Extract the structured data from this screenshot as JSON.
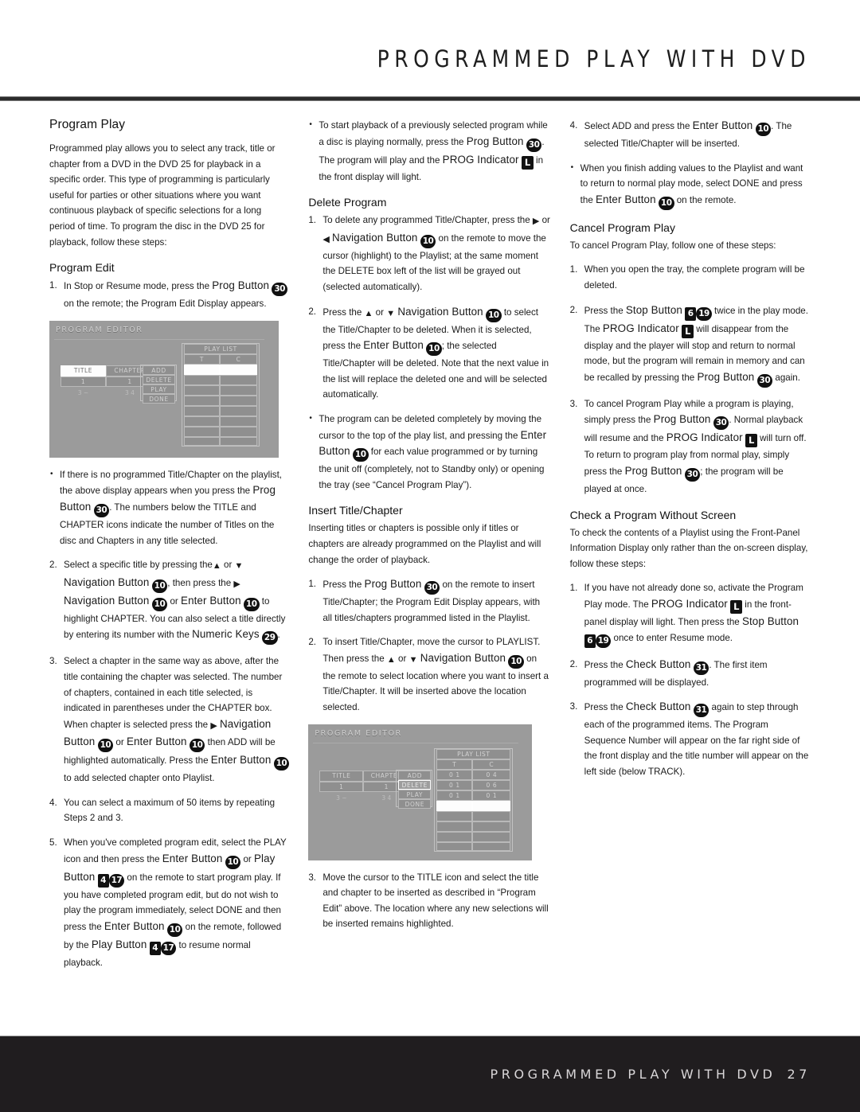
{
  "header": {
    "title": "PROGRAMMED PLAY WITH DVD"
  },
  "footer": {
    "title": "PROGRAMMED PLAY WITH DVD",
    "page": "27"
  },
  "column1": {
    "heading": "Program Play",
    "intro": "Programmed play allows you to select any track, title or chapter from a DVD in the DVD 25 for playback in a specific order. This type of programming is particularly useful for parties or other situations where you want continuous playback of specific selections for a long period of time. To program the disc in the DVD 25 for playback, follow these steps:",
    "subheading": "Program Edit",
    "step1_num": "1.",
    "step1_a": "In Stop or Resume mode, press the ",
    "step1_prog": "Prog Button",
    "step1_key": "30",
    "step1_b": " on the remote; the Program Edit Display appears.",
    "bullet1_a": "If there is no programmed Title/Chapter on the playlist, the above display appears when you press the ",
    "bullet1_prog": "Prog Button",
    "bullet1_key": "30",
    "bullet1_b": ". The numbers below the TITLE and CHAPTER icons indicate the number of Titles on the disc and Chapters in any title selected.",
    "step2_num": "2.",
    "step2_a": "Select a specific title by pressing the",
    "step2_up": "▲",
    "step2_or": " or ",
    "step2_down": "▼",
    "step2_nav1": "Navigation Button",
    "step2_key1": "10",
    "step2_b": ", then press the ",
    "step2_right": "▶",
    "step2_nav2": "Navigation Button",
    "step2_key2": "10",
    "step2_c": " or ",
    "step2_enter": "Enter Button",
    "step2_key3": "10",
    "step2_d": " to highlight CHAPTER. You can also select a title directly by entering its number with the ",
    "step2_numeric": "Numeric Keys",
    "step2_key4": "29",
    "step2_e": ".",
    "step3_num": "3.",
    "step3_a": "Select a chapter in the same way as above, after the title containing the chapter was selected. The number of chapters, contained in each title selected, is indicated in parentheses under the CHAPTER box. When chapter is selected press the ",
    "step3_right": "▶",
    "step3_nav": "Navigation Button",
    "step3_key1": "10",
    "step3_b": " or  ",
    "step3_enter1": "Enter Button",
    "step3_key2": "10",
    "step3_c": " then ADD will be highlighted automatically. Press the ",
    "step3_enter2": "Enter Button",
    "step3_key3": "10",
    "step3_d": " to add selected chapter onto Playlist.",
    "step4_num": "4.",
    "step4": "You can select a maximum of 50 items by repeating Steps 2 and 3.",
    "step5_num": "5.",
    "step5_a": "When you've completed program edit, select the PLAY icon and then press the ",
    "step5_enter1": "Enter Button",
    "step5_key1": "10",
    "step5_b": " or ",
    "step5_play1": "Play Button",
    "step5_key2a": "4",
    "step5_key2b": "17",
    "step5_c": " on the remote to start program play. If you have completed program edit, but do not wish to play the program immediately, select DONE and then press the ",
    "step5_enter2": "Enter Button",
    "step5_key3": "10",
    "step5_d": " on the remote, followed by the ",
    "step5_play2": "Play Button",
    "step5_key4a": "4",
    "step5_key4b": "17",
    "step5_e": " to resume normal playback."
  },
  "column2": {
    "bullet1_a": "To start playback of a previously selected program while a disc is playing normally, press the ",
    "bullet1_prog": "Prog Button",
    "bullet1_key": "30",
    "bullet1_b": ". The program will play and the ",
    "bullet1_prog_ind": "PROG Indicator",
    "bullet1_key2": "L",
    "bullet1_c": " in the front display will light.",
    "subheading1": "Delete Program",
    "step1_num": "1.",
    "step1_a": "To delete any programmed Title/Chapter, press the ",
    "step1_right": "▶",
    "step1_or": " or ",
    "step1_left": "◀",
    "step1_nav": "Navigation Button",
    "step1_key": "10",
    "step1_b": " on the remote to move the cursor (highlight) to the Playlist; at the same moment the DELETE box left of the list will be grayed out (selected automatically).",
    "step2_num": "2.",
    "step2_a": "Press the ",
    "step2_up": "▲",
    "step2_or": " or ",
    "step2_down": "▼",
    "step2_nav": "Navigation Button",
    "step2_key1": "10",
    "step2_b": " to select the Title/Chapter to be deleted. When it is selected, press the ",
    "step2_enter": "Enter Button",
    "step2_key2": "10",
    "step2_c": "; the selected Title/Chapter will be deleted. Note that the next value in the list will replace the deleted one and will be selected automatically.",
    "bullet2_a": "The program can be deleted completely by moving the cursor to the top of the play list, and pressing the ",
    "bullet2_enter": "Enter Button",
    "bullet2_key": "10",
    "bullet2_b": " for each value programmed or by turning the unit off (completely, not to Standby only) or opening the tray (see “Cancel Program Play”).",
    "subheading2": "Insert Title/Chapter",
    "para2": "Inserting titles or chapters is possible only if titles or chapters are already programmed on the Playlist and will change the order of playback.",
    "step3_num": "1.",
    "step3_a": "Press the ",
    "step3_prog": "Prog Button",
    "step3_key": "30",
    "step3_b": " on the remote to insert Title/Chapter; the Program Edit Display appears, with all titles/chapters programmed listed in the Playlist.",
    "step4_num": "2.",
    "step4_a": "To insert Title/Chapter, move the cursor to PLAYLIST. Then press the ",
    "step4_up": "▲",
    "step4_or": " or ",
    "step4_down": "▼",
    "step4_nav": "Navigation Button",
    "step4_key": "10",
    "step4_b": " on the remote to select location where you want to insert a Title/Chapter. It will be inserted above the location selected.",
    "step5_num": "3.",
    "step5": "Move the cursor to the TITLE icon and select the title and chapter to be inserted as described in “Program Edit” above. The location where any new selections will be inserted remains highlighted."
  },
  "column3": {
    "step1_num": "4.",
    "step1_a": "Select ADD and press the ",
    "step1_enter": "Enter Button",
    "step1_key": "10",
    "step1_b": ". The selected Title/Chapter will be inserted.",
    "bullet1_a": "When you finish adding values to the Playlist and want to return to normal play mode, select DONE and press the ",
    "bullet1_enter": "Enter Button",
    "bullet1_key": "10",
    "bullet1_b": " on the remote.",
    "subheading1": "Cancel Program Play",
    "para1": "To cancel Program Play, follow one of these steps:",
    "step2_num": "1.",
    "step2": "When you open the tray, the complete program will be deleted.",
    "step3_num": "2.",
    "step3_a": "Press the ",
    "step3_stop": "Stop Button",
    "step3_key1a": "6",
    "step3_key1b": "19",
    "step3_b": " twice in the play mode. The ",
    "step3_prog_ind": "PROG Indicator",
    "step3_key2": "L",
    "step3_c": " will disappear from the display and the player will stop and return to normal mode, but the program will remain in memory and can be recalled by pressing the ",
    "step3_prog": "Prog Button",
    "step3_key3": "30",
    "step3_d": " again.",
    "step4_num": "3.",
    "step4_a": "To cancel Program Play while a program is playing, simply press the ",
    "step4_prog1": "Prog Button",
    "step4_key1": "30",
    "step4_b": ". Normal playback will resume and the ",
    "step4_prog_ind": "PROG Indicator",
    "step4_key2": "L",
    "step4_c": " will turn off. To return to program play from normal play, simply press the ",
    "step4_prog2": "Prog Button",
    "step4_key3": "30",
    "step4_d": "; the program will be played at once.",
    "subheading2": "Check a Program Without Screen",
    "para2": "To check the contents of a Playlist using the Front-Panel Information Display only rather than the on-screen display, follow these steps:",
    "step5_num": "1.",
    "step5_a": "If you have not already done so, activate the Program Play mode. The ",
    "step5_prog_ind": "PROG Indicator",
    "step5_key1": "L",
    "step5_b": " in the front-panel display will light. Then press the ",
    "step5_stop": "Stop Button",
    "step5_key2a": "6",
    "step5_key2b": "19",
    "step5_c": " once to enter Resume mode.",
    "step6_num": "2.",
    "step6_a": "Press the ",
    "step6_check": "Check Button",
    "step6_key": "31",
    "step6_b": ". The first item programmed will be displayed.",
    "step7_num": "3.",
    "step7_a": "Press the ",
    "step7_check": "Check Button",
    "step7_key": "31",
    "step7_b": " again to step through each of the programmed items. The Program Sequence Number will appear on the far right side of the front display and the title number will appear on the left side (below TRACK)."
  },
  "osd1": {
    "title": "PROGRAM EDITOR",
    "title_label": "TITLE",
    "chapter_label": "CHAPTER",
    "title_value": "1",
    "chapter_value": "1",
    "title_count": "3 ~",
    "chapter_count": "3 4",
    "menu": [
      "ADD",
      "DELETE",
      "PLAY",
      "DONE"
    ],
    "playlist_label": "PLAY LIST",
    "col_t": "T",
    "col_c": "C",
    "rows": [
      {
        "t": "",
        "c": ""
      }
    ]
  },
  "osd2": {
    "title": "PROGRAM EDITOR",
    "title_label": "TITLE",
    "chapter_label": "CHAPTER",
    "title_value": "1",
    "chapter_value": "1",
    "title_count": "3 ~",
    "chapter_count": "3 4",
    "menu": [
      "ADD",
      "DELETE",
      "PLAY",
      "DONE"
    ],
    "playlist_label": "PLAY LIST",
    "col_t": "T",
    "col_c": "C",
    "rows": [
      {
        "t": "0 1",
        "c": "0 4"
      },
      {
        "t": "0 1",
        "c": "0 6"
      },
      {
        "t": "0 1",
        "c": "0 1"
      },
      {
        "t": "",
        "c": ""
      }
    ]
  }
}
